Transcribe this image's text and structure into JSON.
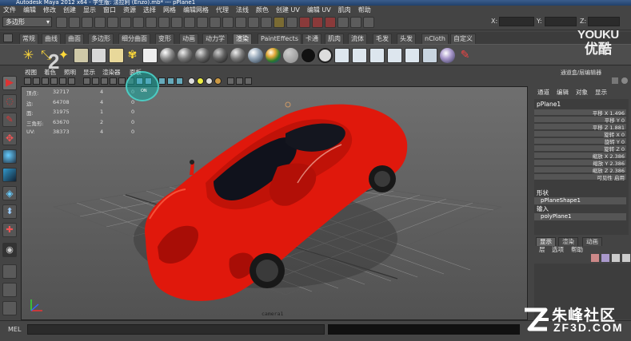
{
  "titlebar": {
    "title": "Autodesk Maya 2012 x64 - 学生版: 法拉利 (Enzo).mb* --- pPlane1"
  },
  "menubar": {
    "items": [
      "文件",
      "编辑",
      "修改",
      "创建",
      "显示",
      "窗口",
      "资源",
      "选择",
      "网格",
      "编辑网格",
      "代理",
      "法线",
      "颜色",
      "创建 UV",
      "编辑 UV",
      "肌肉",
      "帮助"
    ]
  },
  "statusline": {
    "mode": "多边形",
    "coord_labels": [
      "X:",
      "Y:",
      "Z:"
    ]
  },
  "shelf": {
    "tabs": [
      "常规",
      "曲线",
      "曲面",
      "多边形",
      "细分曲面",
      "变形",
      "动画",
      "动力学",
      "渲染",
      "PaintEffects",
      "卡通",
      "肌肉",
      "流体",
      "毛发",
      "头发",
      "nCloth",
      "自定义"
    ],
    "active_tab": "渲染"
  },
  "viewport": {
    "menu": [
      "视图",
      "着色",
      "照明",
      "显示",
      "渲染器",
      "面板"
    ],
    "hud": [
      {
        "label": "顶点:",
        "v1": "32717",
        "v2": "4",
        "v3": "0"
      },
      {
        "label": "边:",
        "v1": "64708",
        "v2": "4",
        "v3": "0"
      },
      {
        "label": "面:",
        "v1": "31975",
        "v2": "1",
        "v3": "0"
      },
      {
        "label": "三角形:",
        "v1": "63670",
        "v2": "2",
        "v3": "0"
      },
      {
        "label": "UV:",
        "v1": "38373",
        "v2": "4",
        "v3": "0"
      }
    ],
    "camera": "camera1",
    "highlight_label": "ON"
  },
  "channel_box": {
    "header": "通道盒/层编辑器",
    "menu": [
      "通道",
      "编辑",
      "对象",
      "显示"
    ],
    "node": "pPlane1",
    "attributes": [
      "平移 X 1.496",
      "平移 Y 0",
      "平移 Z 1.881",
      "旋转 X 0",
      "旋转 Y 0",
      "旋转 Z 0",
      "缩放 X 2.386",
      "缩放 Y 2.386",
      "缩放 Z 2.386",
      "可见性 启用"
    ],
    "shape_section": "形状",
    "shape_node": "pPlaneShape1",
    "input_section": "输入",
    "input_node": "polyPlane1"
  },
  "layer_editor": {
    "tabs": [
      "显示",
      "渲染",
      "动画"
    ],
    "active_tab": "显示",
    "menu": [
      "层",
      "选项",
      "帮助"
    ]
  },
  "helpline": {
    "label": "MEL"
  },
  "overlays": {
    "youku_en": "YOUKU",
    "youku_zh": "优酷",
    "zf_zh": "朱峰社区",
    "zf_en": "ZF3D.COM",
    "number": "2"
  },
  "colors": {
    "car_body": "#e0180c",
    "highlight": "#14aaa0",
    "ui_bg": "#444444"
  }
}
